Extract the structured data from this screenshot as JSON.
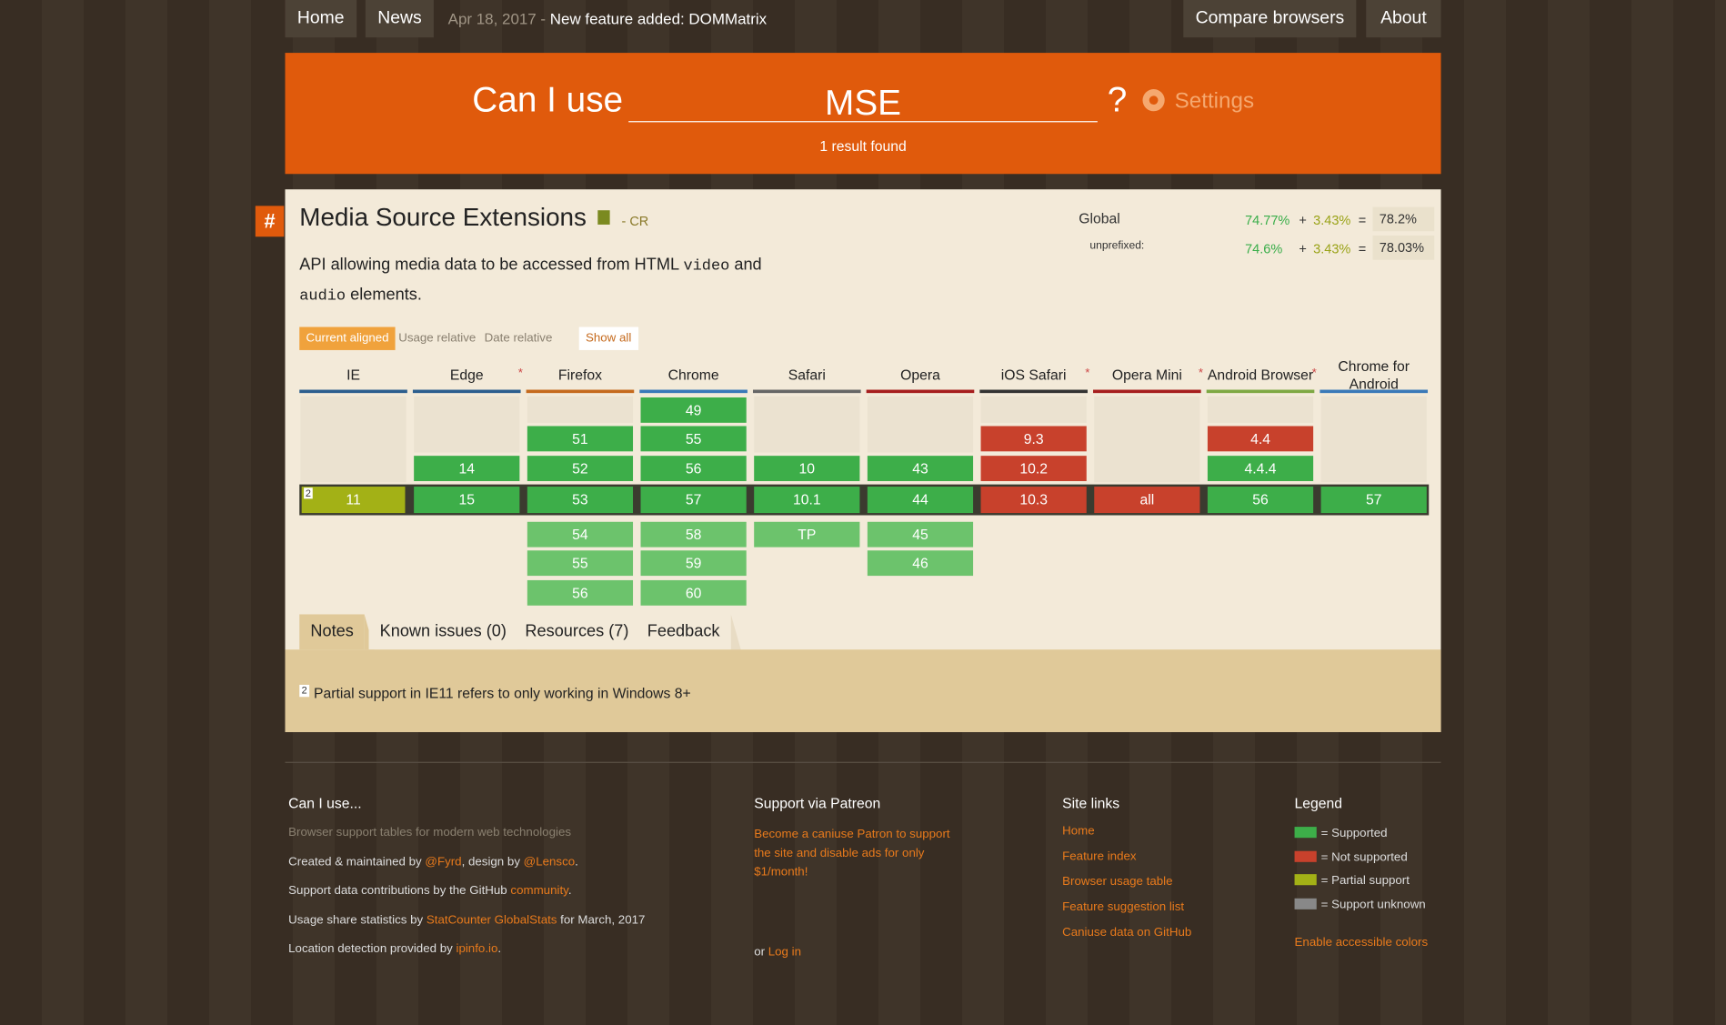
{
  "nav": {
    "home": "Home",
    "news": "News",
    "news_date": "Apr 18, 2017 -",
    "news_headline": "New feature added: DOMMatrix",
    "compare": "Compare browsers",
    "about": "About"
  },
  "search": {
    "prefix": "Can I use",
    "query": "MSE",
    "qmark": "?",
    "settings": "Settings",
    "result_count": "1 result found"
  },
  "feature": {
    "hash": "#",
    "title": "Media Source Extensions",
    "status": "- CR",
    "desc_1": "API allowing media data to be accessed from HTML ",
    "desc_code_1": "video",
    "desc_2": " and",
    "desc_code_2": "audio",
    "desc_3": " elements."
  },
  "usage": {
    "global_label": "Global",
    "unprefixed_label": "unprefixed:",
    "global_full": "74.77%",
    "global_partial": "3.43%",
    "global_total": "78.2%",
    "unprefixed_full": "74.6%",
    "unprefixed_partial": "3.43%",
    "unprefixed_total": "78.03%",
    "plus": "+",
    "equals": "="
  },
  "view_tabs": {
    "current": "Current aligned",
    "usage": "Usage relative",
    "date": "Date relative",
    "show_all": "Show all"
  },
  "browsers": [
    {
      "name": "IE",
      "star": "",
      "color": "#2c5e8e"
    },
    {
      "name": "Edge",
      "star": "*",
      "color": "#2c5e8e"
    },
    {
      "name": "Firefox",
      "star": "",
      "color": "#c56a1d"
    },
    {
      "name": "Chrome",
      "star": "",
      "color": "#3a79b8"
    },
    {
      "name": "Safari",
      "star": "",
      "color": "#666666"
    },
    {
      "name": "Opera",
      "star": "",
      "color": "#a61e1e"
    },
    {
      "name": "iOS Safari",
      "star": "*",
      "color": "#333333"
    },
    {
      "name": "Opera Mini",
      "star": "*",
      "color": "#a61e1e"
    },
    {
      "name": "Android Browser",
      "star": "*",
      "color": "#7ea843"
    },
    {
      "name": "Chrome for Android",
      "star": "",
      "color": "#3a79b8"
    }
  ],
  "cells": {
    "ie": {
      "cur": "11"
    },
    "edge": {
      "p1": "14",
      "cur": "15"
    },
    "firefox": {
      "p3": "51",
      "p1": "52",
      "cur": "53",
      "f1": "54",
      "f2": "55",
      "f3": "56"
    },
    "chrome": {
      "p4": "49",
      "p3": "55",
      "p1": "56",
      "cur": "57",
      "f1": "58",
      "f2": "59",
      "f3": "60"
    },
    "safari": {
      "p1": "10",
      "cur": "10.1",
      "f1": "TP"
    },
    "opera": {
      "p1": "43",
      "cur": "44",
      "f1": "45",
      "f2": "46"
    },
    "ios": {
      "p3": "9.3",
      "p1": "10.2",
      "cur": "10.3"
    },
    "operamini": {
      "cur": "all"
    },
    "android": {
      "p3": "4.4",
      "p1": "4.4.4",
      "cur": "56"
    },
    "chromeandroid": {
      "cur": "57"
    }
  },
  "note_ref": "2",
  "info_tabs": {
    "notes": "Notes",
    "issues": "Known issues (0)",
    "resources": "Resources (7)",
    "feedback": "Feedback"
  },
  "note_text": "Partial support in IE11 refers to only working in Windows 8+",
  "footer": {
    "col1_title": "Can I use...",
    "col1_sub": "Browser support tables for modern web technologies",
    "created_a": "Created & maintained by ",
    "created_fyrd": "@Fyrd",
    "created_b": ", design by ",
    "created_lensco": "@Lensco",
    "created_c": ".",
    "contrib_a": "Support data contributions by the GitHub ",
    "contrib_link": "community",
    "contrib_b": ".",
    "stats_a": "Usage share statistics by ",
    "stats_link": "StatCounter GlobalStats",
    "stats_b": " for March, 2017",
    "loc_a": "Location detection provided by ",
    "loc_link": "ipinfo.io",
    "loc_b": ".",
    "col2_title": "Support via Patreon",
    "patreon_text": "Become a caniuse Patron to support the site and disable ads for only $1/month!",
    "or": "or ",
    "login": "Log in",
    "col3_title": "Site links",
    "site_links": [
      "Home",
      "Feature index",
      "Browser usage table",
      "Feature suggestion list",
      "Caniuse data on GitHub"
    ],
    "col4_title": "Legend",
    "legend": [
      {
        "label": "= Supported",
        "color": "#3dae49"
      },
      {
        "label": "= Not supported",
        "color": "#c8412c"
      },
      {
        "label": "= Partial support",
        "color": "#a3b116"
      },
      {
        "label": "= Support unknown",
        "color": "#888888"
      }
    ],
    "accessible": "Enable accessible colors"
  }
}
